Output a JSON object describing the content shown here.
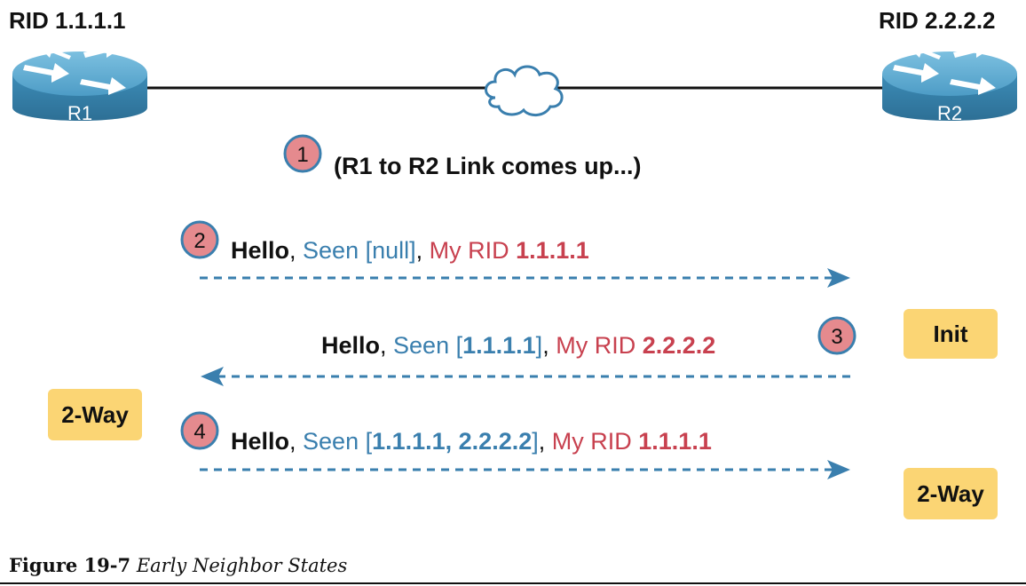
{
  "routers": {
    "r1": {
      "rid": "RID 1.1.1.1",
      "name": "R1"
    },
    "r2": {
      "rid": "RID 2.2.2.2",
      "name": "R2"
    }
  },
  "steps": {
    "s1": {
      "num": "1",
      "text": "(R1 to R2 Link comes up...)"
    },
    "s2": {
      "num": "2",
      "hello": "Hello",
      "sep1": ", ",
      "seen_label": "Seen [",
      "seen_value": "null",
      "seen_close": "]",
      "sep2": ", ",
      "myrid_label": "My RID ",
      "myrid_value": "1.1.1.1"
    },
    "s3": {
      "num": "3",
      "hello": "Hello",
      "sep1": ", ",
      "seen_label": "Seen [",
      "seen_value": "1.1.1.1",
      "seen_close": "]",
      "sep2": ", ",
      "myrid_label": "My RID ",
      "myrid_value": "2.2.2.2"
    },
    "s4": {
      "num": "4",
      "hello": "Hello",
      "sep1": ", ",
      "seen_label": "Seen [",
      "seen_value": "1.1.1.1, 2.2.2.2",
      "seen_close": "]",
      "sep2": ", ",
      "myrid_label": "My RID ",
      "myrid_value": "1.1.1.1"
    }
  },
  "states": {
    "r2_init": "Init",
    "r1_2way": "2-Way",
    "r2_2way": "2-Way"
  },
  "caption": {
    "figure": "Figure 19-7",
    "title": "Early Neighbor States"
  },
  "colors": {
    "router_body": "#3f8fb8",
    "step_circle": "#e58a8e",
    "state_box": "#fbd574",
    "arrow": "#3a7fae",
    "text_blue": "#3a7fae",
    "text_red": "#c8414f"
  }
}
